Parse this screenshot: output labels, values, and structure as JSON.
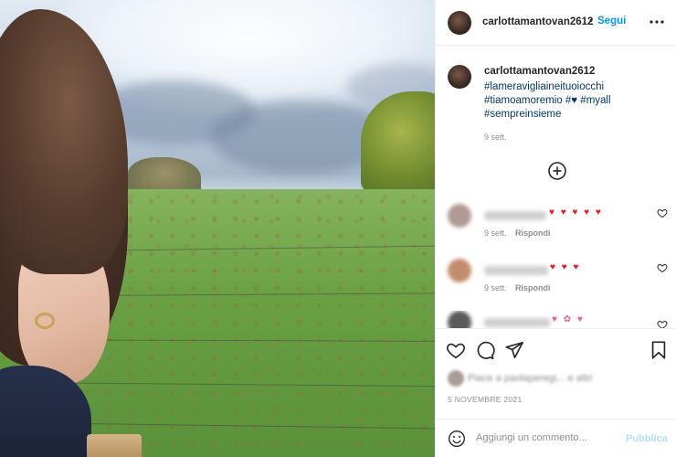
{
  "post": {
    "username": "carlottamantovan2612",
    "follow_label": "Segui",
    "separator": "•",
    "caption": {
      "username": "carlottamantovan2612",
      "tag1": "#lameravigliaineituoiocchi",
      "tag2": "#tiamoamoremio",
      "tag3": "#",
      "tag4": "#myall",
      "tag5": "#sempreinsieme",
      "time": "9 sett."
    },
    "comments": [
      {
        "meta": "9 sett.",
        "reply_label": "Rispondi",
        "hearts": "♥ ♥ ♥ ♥ ♥"
      },
      {
        "meta": "9 sett.",
        "reply_label": "Rispondi",
        "hearts": "♥ ♥ ♥"
      },
      {
        "hearts": "♥ ✿ ♥"
      }
    ],
    "liked_by": "Piace a paolaperegi... e altri",
    "date": "5 NOVEMBRE 2021",
    "comment_placeholder": "Aggiungi un commento...",
    "publish_label": "Pubblica"
  },
  "icons": {
    "more": "more-options-icon",
    "load_more": "add-circle-icon",
    "like": "heart-outline-icon",
    "comment": "comment-icon",
    "share": "paper-plane-icon",
    "save": "bookmark-icon",
    "emoji": "smiley-icon"
  },
  "colors": {
    "accent": "#0095f6",
    "hashtag": "#00376b",
    "heart": "#ed1c24",
    "publish_disabled": "#b2dffc"
  }
}
